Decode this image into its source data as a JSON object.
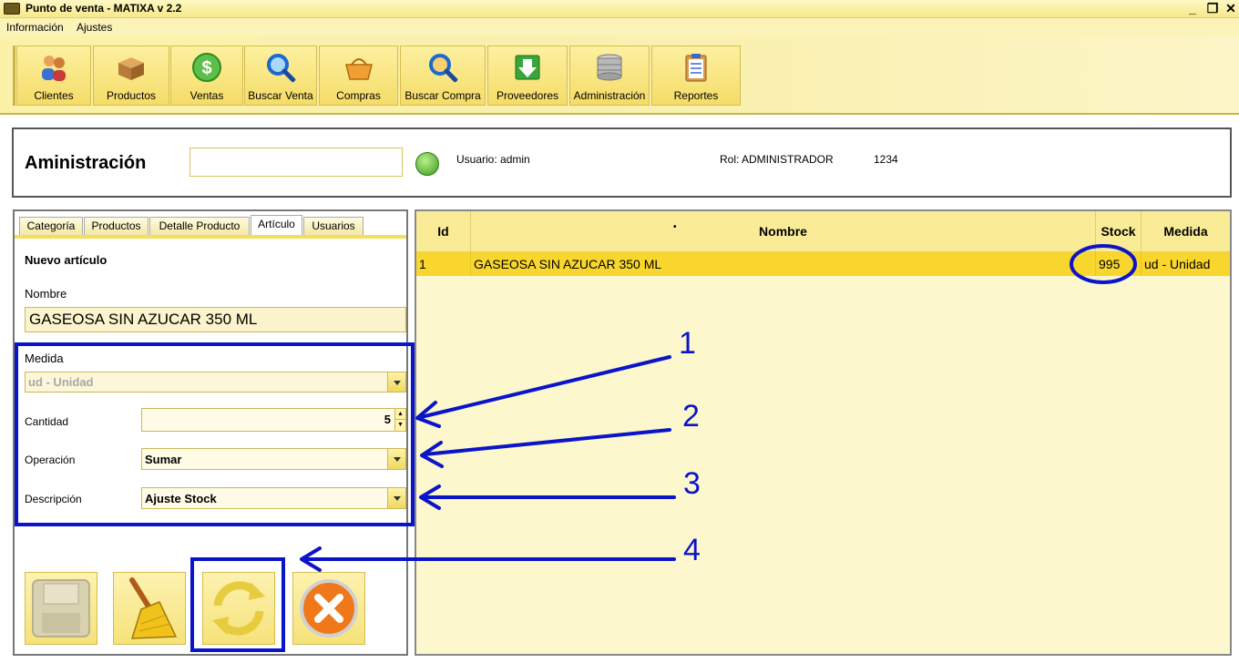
{
  "window": {
    "title": "Punto de venta - MATIXA v 2.2",
    "minimize": "_",
    "maximize": "❐",
    "close": "✕"
  },
  "menubar": {
    "items": [
      "Información",
      "Ajustes"
    ]
  },
  "toolbar": {
    "buttons": [
      {
        "label": "Clientes",
        "icon": "clients-icon"
      },
      {
        "label": "Productos",
        "icon": "products-box-icon"
      },
      {
        "label": "Ventas",
        "icon": "dollar-coin-icon"
      },
      {
        "label": "Buscar Venta",
        "icon": "magnifier-icon"
      },
      {
        "label": "Compras",
        "icon": "shopping-basket-icon"
      },
      {
        "label": "Buscar Compra",
        "icon": "magnifier-box-icon"
      },
      {
        "label": "Proveedores",
        "icon": "supplier-download-icon"
      },
      {
        "label": "Administración",
        "icon": "database-icon"
      },
      {
        "label": "Reportes",
        "icon": "clipboard-report-icon"
      }
    ]
  },
  "header": {
    "title": "Aministración",
    "search_value": "",
    "user": "Usuario: admin",
    "role": "Rol: ADMINISTRADOR",
    "code": "1234"
  },
  "tabs": [
    {
      "label": "Categoría",
      "active": false
    },
    {
      "label": "Productos",
      "active": false
    },
    {
      "label": "Detalle Producto",
      "active": false
    },
    {
      "label": "Artículo",
      "active": true
    },
    {
      "label": "Usuarios",
      "active": false
    }
  ],
  "form": {
    "section_title": "Nuevo artículo",
    "nombre_label": "Nombre",
    "nombre_value": "GASEOSA SIN AZUCAR 350 ML",
    "medida_label": "Medida",
    "medida_value": "ud - Unidad",
    "cantidad_label": "Cantidad",
    "cantidad_value": "5",
    "operacion_label": "Operación",
    "operacion_value": "Sumar",
    "descripcion_label": "Descripción",
    "descripcion_value": "Ajuste Stock"
  },
  "actions": [
    "save-disk-icon",
    "broom-clear-icon",
    "refresh-arrows-icon",
    "cancel-x-icon"
  ],
  "table": {
    "columns": [
      "Id",
      "Nombre",
      "Stock",
      "Medida"
    ],
    "sort_marker": "•",
    "rows": [
      [
        "1",
        "GASEOSA SIN AZUCAR 350 ML",
        "995",
        "ud - Unidad"
      ]
    ]
  },
  "annotations": {
    "numbers": [
      "1",
      "2",
      "3",
      "4"
    ],
    "color": "#0a14c8"
  }
}
